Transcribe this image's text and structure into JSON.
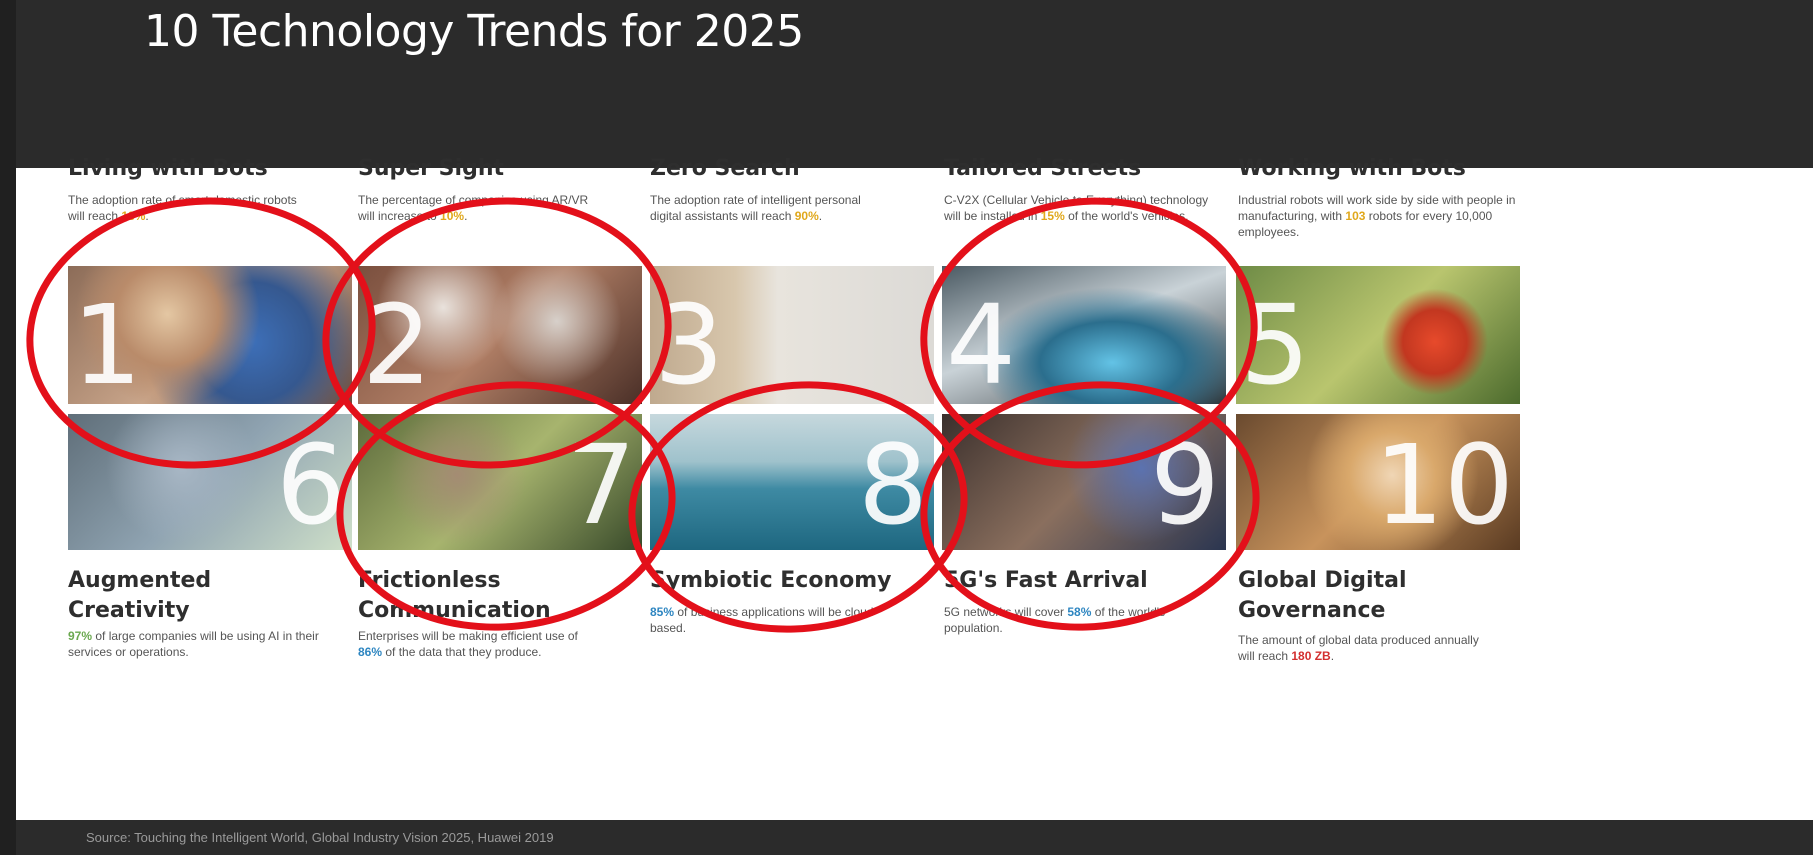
{
  "title": "10 Technology Trends for 2025",
  "footer": "Source: Touching the Intelligent World, Global Industry Vision 2025, Huawei 2019",
  "colors": {
    "accent_yellow": "#e0a81c",
    "accent_green": "#6aa84f",
    "accent_blue": "#2e86c1",
    "accent_red": "#d32f2f",
    "annotation_red": "#e3101a"
  },
  "trends": [
    {
      "number": "1",
      "heading": "Living with Bots",
      "desc_pre": "The adoption rate of smart domestic robots will reach ",
      "stat": "18%",
      "desc_post": "."
    },
    {
      "number": "2",
      "heading": "Super Sight",
      "desc_pre": "The percentage of companies using AR/VR will increase to ",
      "stat": "10%",
      "desc_post": "."
    },
    {
      "number": "3",
      "heading": "Zero Search",
      "desc_pre": "The adoption rate of intelligent personal digital assistants will reach ",
      "stat": "90%",
      "desc_post": "."
    },
    {
      "number": "4",
      "heading": "Tailored Streets",
      "desc_pre": "C-V2X (Cellular Vehicle to Everything) technology will be installed in ",
      "stat": "15%",
      "desc_post": " of the world's vehicles."
    },
    {
      "number": "5",
      "heading": "Working with Bots",
      "desc_pre": "Industrial robots will work side by side with people in manufacturing, with ",
      "stat": "103",
      "desc_post": " robots for every 10,000 employees."
    },
    {
      "number": "6",
      "heading": "Augmented Creativity",
      "desc_pre": "",
      "stat": "97%",
      "desc_post": " of large companies will be using AI in their services or operations."
    },
    {
      "number": "7",
      "heading": "Frictionless Communication",
      "desc_pre": "Enterprises will be making efficient use of ",
      "stat": "86%",
      "desc_post": " of the data that they produce."
    },
    {
      "number": "8",
      "heading": "Symbiotic Economy",
      "desc_pre": "",
      "stat": "85%",
      "desc_post": " of business applications will be cloud-based."
    },
    {
      "number": "9",
      "heading": "5G's Fast Arrival",
      "desc_pre": "5G networks will cover ",
      "stat": "58%",
      "desc_post": " of the world's population."
    },
    {
      "number": "10",
      "heading": "Global Digital Governance",
      "desc_pre": "The amount of global data produced annually will reach ",
      "stat": "180 ZB",
      "desc_post": "."
    }
  ]
}
